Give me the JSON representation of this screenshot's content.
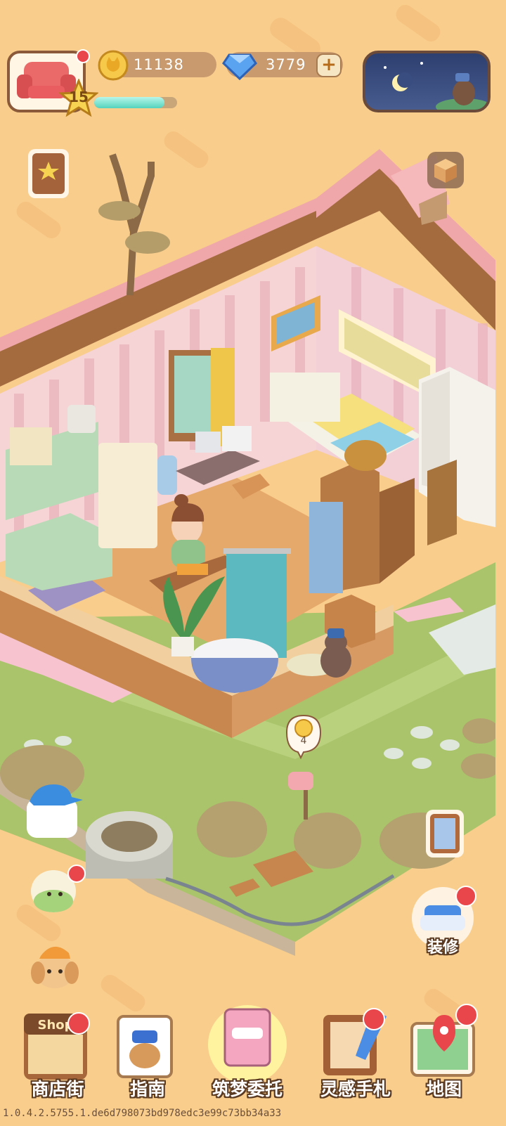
{
  "hud": {
    "level": "15",
    "xp_progress": 0.85,
    "coins": "11138",
    "gems": "3779",
    "plus_label": "+"
  },
  "decorate": {
    "label": "装修"
  },
  "reward_bubble": {
    "count": "4"
  },
  "nav": {
    "items": [
      {
        "label": "商店街",
        "sign": "Shop"
      },
      {
        "label": "指南"
      },
      {
        "label": "筑梦委托"
      },
      {
        "label": "灵感手札"
      },
      {
        "label": "地图"
      }
    ]
  },
  "version": "1.0.4.2.5755.1.de6d798073bd978edc3e99c73bb34a33",
  "colors": {
    "background": "#f9cd8c",
    "grass": "#a9c46a",
    "roof": "#f0a7aa",
    "badge_red": "#e8464a"
  }
}
